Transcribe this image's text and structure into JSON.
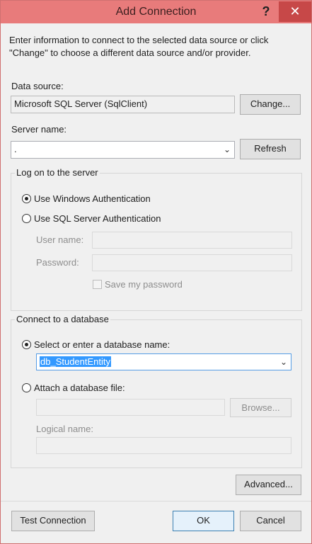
{
  "window": {
    "title": "Add Connection",
    "help_label": "?",
    "close_label": "✕"
  },
  "description": "Enter information to connect to the selected data source or click \"Change\" to choose a different data source and/or provider.",
  "data_source": {
    "label": "Data source:",
    "value": "Microsoft SQL Server (SqlClient)",
    "change_label": "Change..."
  },
  "server": {
    "label": "Server name:",
    "value": ".",
    "refresh_label": "Refresh"
  },
  "logon": {
    "title": "Log on to the server",
    "windows_auth_label": "Use Windows Authentication",
    "sql_auth_label": "Use SQL Server Authentication",
    "username_label": "User name:",
    "username_value": "",
    "password_label": "Password:",
    "password_value": "",
    "save_password_label": "Save my password"
  },
  "database": {
    "title": "Connect to a database",
    "select_label": "Select or enter a database name:",
    "select_value": "db_StudentEntity",
    "attach_label": "Attach a database file:",
    "attach_value": "",
    "browse_label": "Browse...",
    "logical_label": "Logical name:",
    "logical_value": ""
  },
  "advanced_label": "Advanced...",
  "footer": {
    "test_label": "Test Connection",
    "ok_label": "OK",
    "cancel_label": "Cancel"
  },
  "icons": {
    "combo_arrow": "chevron-down-icon"
  },
  "colors": {
    "titlebar": "#e87b7b",
    "close_button": "#c74848",
    "selection": "#3399ff"
  }
}
